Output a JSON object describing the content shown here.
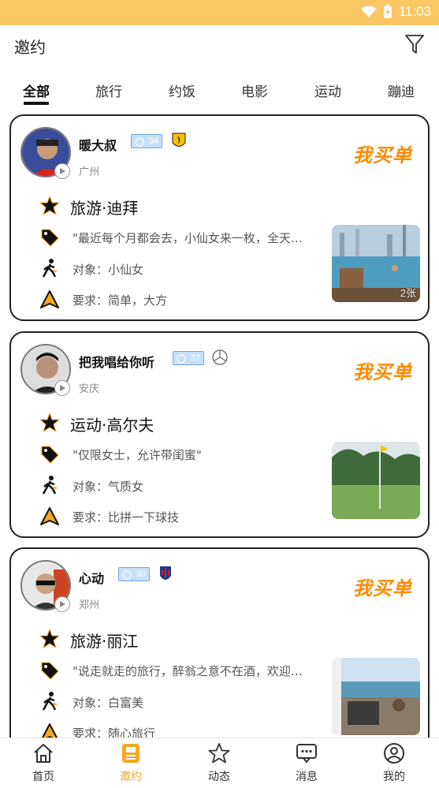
{
  "status_bar": {
    "time": "11:03"
  },
  "header": {
    "title": "邀约"
  },
  "tabs": [
    {
      "label": "全部"
    },
    {
      "label": "旅行"
    },
    {
      "label": "约饭"
    },
    {
      "label": "电影"
    },
    {
      "label": "运动"
    },
    {
      "label": "蹦迪"
    }
  ],
  "colors": {
    "accent": "#f5a623",
    "status_bar": "#fbc763",
    "buy_badge": "#ff8a00",
    "level_badge": "#c7e0fa"
  },
  "cards": [
    {
      "name": "暖大叔",
      "level": "34",
      "car_icon": "ferrari-icon",
      "city": "广州",
      "buy_label": "我买单",
      "topic": "旅游·迪拜",
      "desc": "\"最近每个月都会去，小仙女来一枚，全天陪同",
      "target": "对象：小仙女",
      "requirement": "要求：简单，大方",
      "photo_count": "2张"
    },
    {
      "name": "把我唱给你听",
      "level": "27",
      "car_icon": "mercedes-icon",
      "city": "安庆",
      "buy_label": "我买单",
      "topic": "运动·高尔夫",
      "desc": "\"仅限女士，允许带闺蜜\"",
      "target": "对象：气质女",
      "requirement": "要求：比拼一下球技",
      "photo_count": ""
    },
    {
      "name": "心动",
      "level": "30",
      "car_icon": "maserati-icon",
      "city": "郑州",
      "buy_label": "我买单",
      "topic": "旅游·丽江",
      "desc": "\"说走就走的旅行，醉翁之意不在酒，欢迎同行",
      "target": "对象：白富美",
      "requirement": "要求：随心旅行",
      "photo_count": ""
    }
  ],
  "bottom_nav": [
    {
      "label": "首页"
    },
    {
      "label": "邀约"
    },
    {
      "label": "动态"
    },
    {
      "label": "消息"
    },
    {
      "label": "我的"
    }
  ]
}
